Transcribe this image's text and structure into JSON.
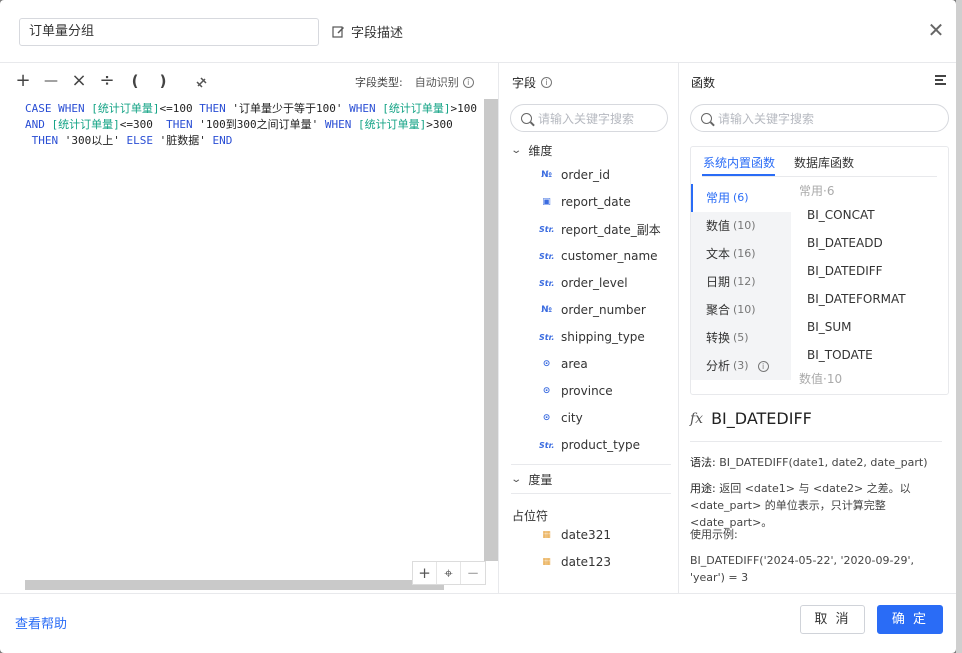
{
  "header": {
    "field_name_value": "订单量分组",
    "desc_label": "字段描述"
  },
  "toolbar": {
    "ops": [
      "+",
      "—",
      "×",
      "÷",
      "(",
      ")"
    ],
    "field_type_label": "字段类型:",
    "field_type_value": "自动识别"
  },
  "editor": {
    "lines": [
      [
        [
          "kw",
          "CASE WHEN "
        ],
        [
          "fld",
          "[统计订单量]"
        ],
        [
          "num",
          "<=100 "
        ],
        [
          "kw",
          "THEN "
        ],
        [
          "str",
          "'订单量少于等于100' "
        ],
        [
          "kw",
          "WHEN "
        ],
        [
          "fld",
          "[统计订单量]"
        ],
        [
          "num",
          ">100"
        ]
      ],
      [
        [
          "kw",
          "AND "
        ],
        [
          "fld",
          "[统计订单量]"
        ],
        [
          "num",
          "<=300  "
        ],
        [
          "kw",
          "THEN "
        ],
        [
          "str",
          "'100到300之间订单量' "
        ],
        [
          "kw",
          "WHEN "
        ],
        [
          "fld",
          "[统计订单量]"
        ],
        [
          "num",
          ">300"
        ]
      ],
      [
        [
          "kw",
          " THEN "
        ],
        [
          "str",
          "'300以上' "
        ],
        [
          "kw",
          "ELSE "
        ],
        [
          "str",
          "'脏数据' "
        ],
        [
          "kw",
          "END"
        ]
      ]
    ]
  },
  "fields_panel": {
    "title": "字段",
    "search_placeholder": "请输入关键字搜索",
    "dimension_label": "维度",
    "dimensions": [
      {
        "icon": "№",
        "type": "number",
        "name": "order_id"
      },
      {
        "icon": "▣",
        "type": "date",
        "name": "report_date"
      },
      {
        "icon": "Str.",
        "type": "string",
        "name": "report_date_副本"
      },
      {
        "icon": "Str.",
        "type": "string",
        "name": "customer_name"
      },
      {
        "icon": "Str.",
        "type": "string",
        "name": "order_level"
      },
      {
        "icon": "№",
        "type": "number",
        "name": "order_number"
      },
      {
        "icon": "Str.",
        "type": "string",
        "name": "shipping_type"
      },
      {
        "icon": "⊙",
        "type": "geo",
        "name": "area"
      },
      {
        "icon": "⊙",
        "type": "geo",
        "name": "province"
      },
      {
        "icon": "⊙",
        "type": "geo",
        "name": "city"
      },
      {
        "icon": "Str.",
        "type": "string",
        "name": "product_type"
      }
    ],
    "measure_label": "度量",
    "placeholder_label": "占位符",
    "placeholders": [
      {
        "icon": "▦",
        "name": "date321"
      },
      {
        "icon": "▦",
        "name": "date123"
      }
    ]
  },
  "functions_panel": {
    "title": "函数",
    "search_placeholder": "请输入关键字搜索",
    "tabs": [
      "系统内置函数",
      "数据库函数"
    ],
    "active_tab": "系统内置函数",
    "categories": [
      {
        "label": "常用",
        "count": "(6)"
      },
      {
        "label": "数值",
        "count": "(10)"
      },
      {
        "label": "文本",
        "count": "(16)"
      },
      {
        "label": "日期",
        "count": "(12)"
      },
      {
        "label": "聚合",
        "count": "(10)"
      },
      {
        "label": "转换",
        "count": "(5)"
      },
      {
        "label": "分析",
        "count": "(3)"
      }
    ],
    "list_group_header": "常用·6",
    "functions": [
      "BI_CONCAT",
      "BI_DATEADD",
      "BI_DATEDIFF",
      "BI_DATEFORMAT",
      "BI_SUM",
      "BI_TODATE"
    ],
    "list_group_footer": "数值·10",
    "detail": {
      "name": "BI_DATEDIFF",
      "syntax_label": "语法:",
      "syntax": "BI_DATEDIFF(date1, date2, date_part)",
      "usage_label": "用途:",
      "usage": "返回 <date1> 与 <date2> 之差。以 <date_part> 的单位表示，只计算完整<date_part>。",
      "example_label": "使用示例:",
      "example": "BI_DATEDIFF('2024-05-22', '2020-09-29', 'year') = 3"
    }
  },
  "footer": {
    "help": "查看帮助",
    "cancel": "取 消",
    "ok": "确 定"
  },
  "colors": {
    "accent": "#2a6cf6",
    "keyword": "#2a4ed4",
    "field_ref": "#13a385",
    "date_icon": "#e6a23c"
  }
}
